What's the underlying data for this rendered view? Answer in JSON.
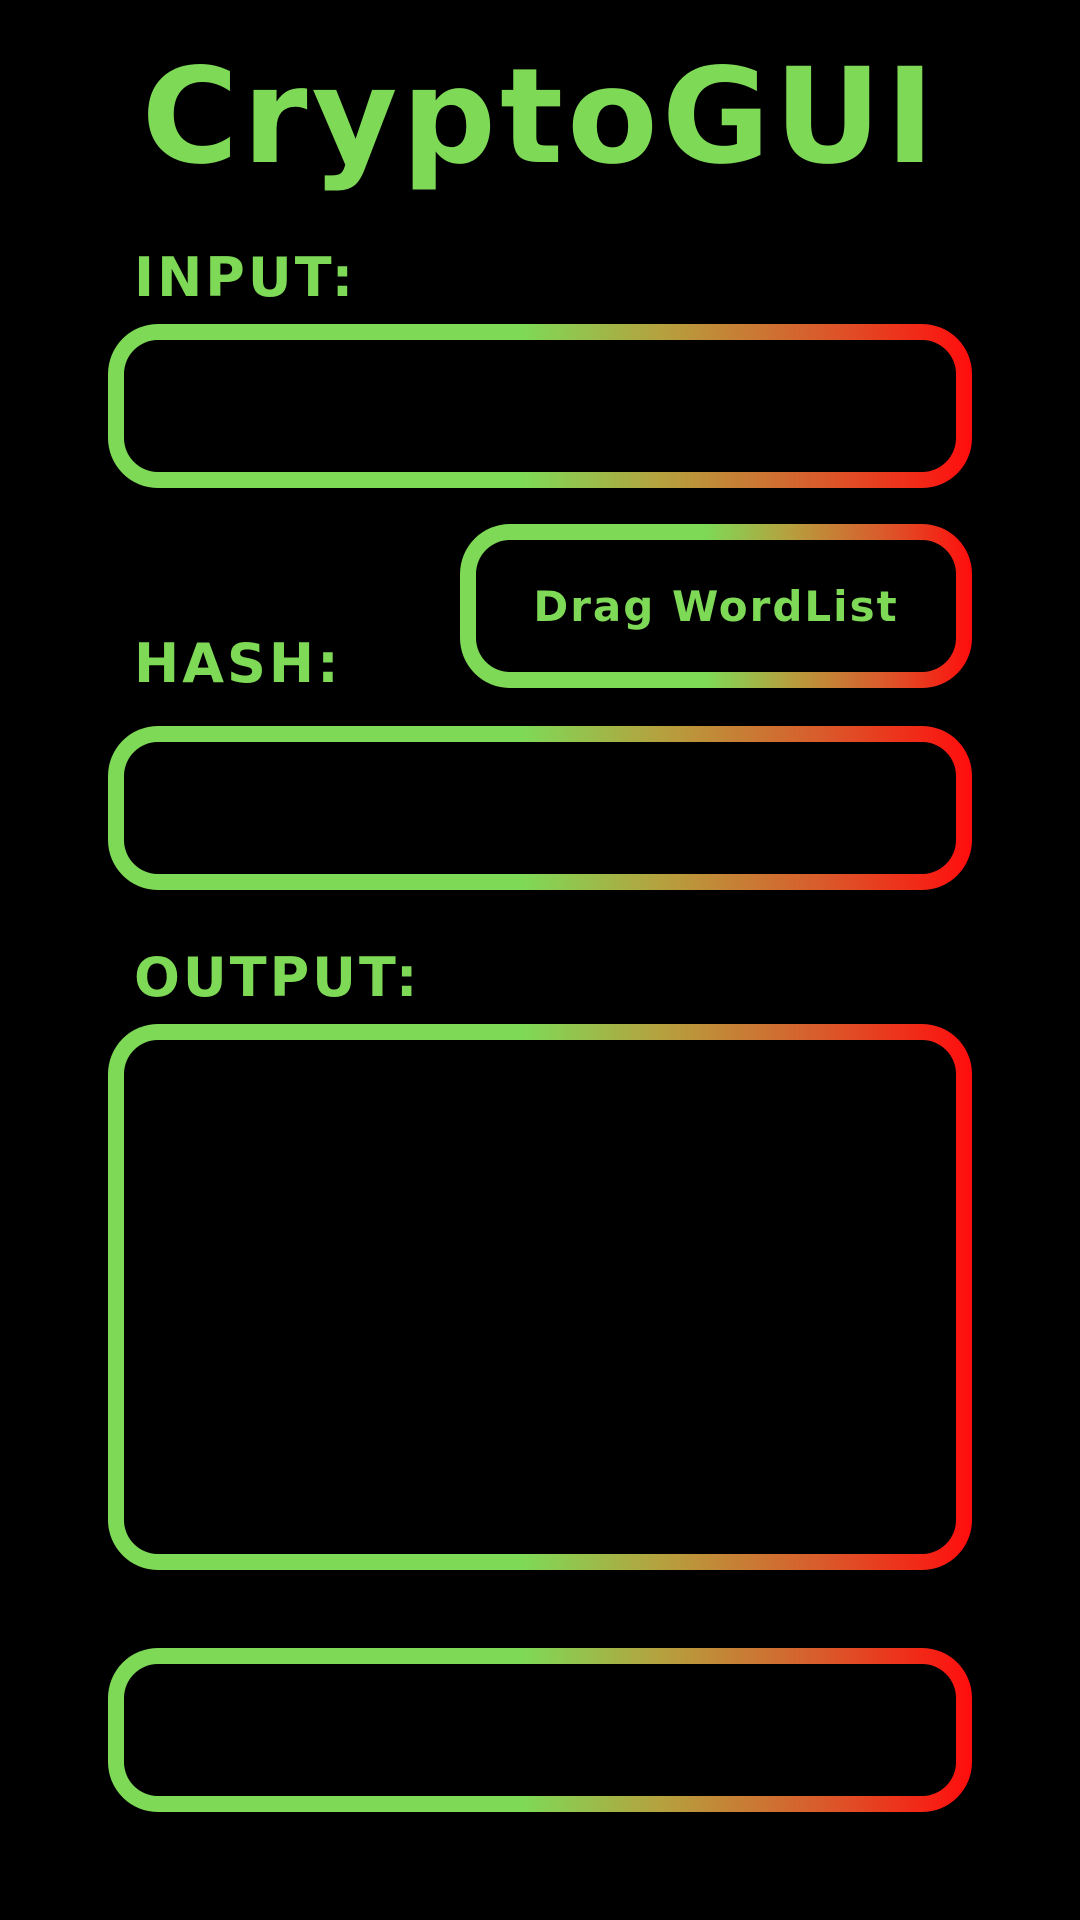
{
  "app": {
    "title": "CryptoGUI"
  },
  "input": {
    "label": "INPUT:",
    "value": "",
    "placeholder": ""
  },
  "wordlist": {
    "button_label": "Drag WordList"
  },
  "hash": {
    "label": "HASH:",
    "value": "",
    "placeholder": ""
  },
  "output": {
    "label": "OUTPUT:",
    "value": ""
  },
  "bottom_field": {
    "value": "",
    "placeholder": ""
  },
  "colors": {
    "background": "#000000",
    "accent_green": "#7ed957",
    "accent_red": "#ff0d0d"
  }
}
